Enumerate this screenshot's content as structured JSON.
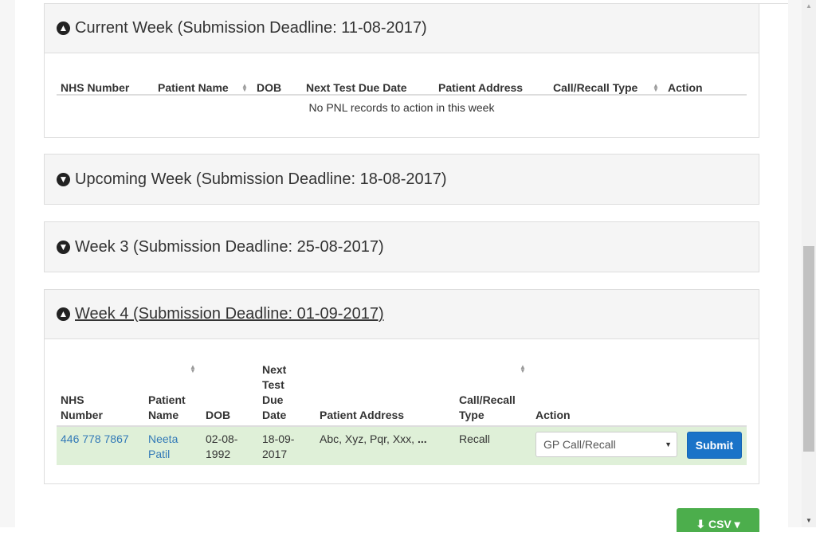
{
  "panels": {
    "current": {
      "title": "Current Week (Submission Deadline: 11-08-2017)",
      "headers": [
        "NHS Number",
        "Patient Name",
        "DOB",
        "Next Test Due Date",
        "Patient Address",
        "Call/Recall Type",
        "Action"
      ],
      "empty_message": "No PNL records to action in this week"
    },
    "upcoming": {
      "title": "Upcoming Week (Submission Deadline: 18-08-2017)"
    },
    "week3": {
      "title": "Week 3 (Submission Deadline: 25-08-2017)"
    },
    "week4": {
      "title": "Week 4 (Submission Deadline: 01-09-2017)",
      "headers": {
        "nhs_line1": "NHS",
        "nhs_line2": "Number",
        "name_line1": "Patient",
        "name_line2": "Name",
        "dob": "DOB",
        "due_line1": "Next",
        "due_line2": "Test",
        "due_line3": "Due",
        "due_line4": "Date",
        "address": "Patient Address",
        "type_line1": "Call/Recall",
        "type_line2": "Type",
        "action": "Action"
      },
      "row": {
        "nhs_number": "446 778 7867",
        "name_line1": "Neeta",
        "name_line2": "Patil",
        "dob_line1": "02-08-",
        "dob_line2": "1992",
        "due_line1": "18-09-",
        "due_line2": "2017",
        "address": "Abc, Xyz, Pqr, Xxx, ",
        "address_more": "...",
        "type": "Recall",
        "action_selected": "GP Call/Recall",
        "submit_label": "Submit"
      }
    }
  },
  "csv_label": "CSV",
  "colors": {
    "row_highlight": "#dff0d8",
    "submit": "#1a73c8",
    "csv": "#4cae4c",
    "link": "#337ab7"
  }
}
